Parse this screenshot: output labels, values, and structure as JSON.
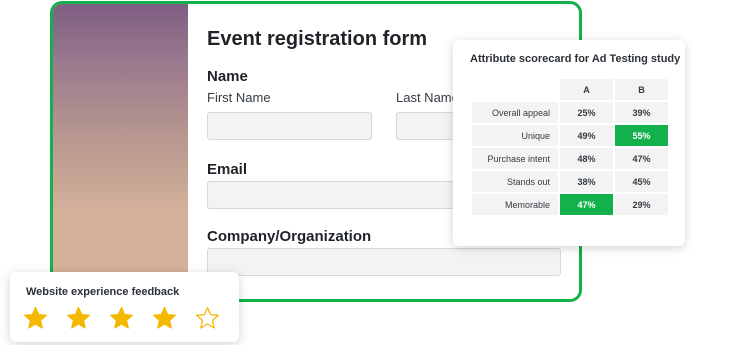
{
  "form": {
    "title": "Event registration form",
    "name_section": "Name",
    "first_name_label": "First Name",
    "last_name_label": "Last Name",
    "email_label": "Email",
    "company_label": "Company/Organization",
    "accent_color": "#12b14b"
  },
  "scorecard": {
    "title": "Attribute scorecard for Ad Testing study",
    "columns": [
      "A",
      "B"
    ],
    "rows": [
      {
        "label": "Overall appeal",
        "a": "25%",
        "b": "39%"
      },
      {
        "label": "Unique",
        "a": "49%",
        "b": "55%"
      },
      {
        "label": "Purchase intent",
        "a": "48%",
        "b": "47%"
      },
      {
        "label": "Stands out",
        "a": "38%",
        "b": "45%"
      },
      {
        "label": "Memorable",
        "a": "47%",
        "b": "29%"
      }
    ],
    "highlight_color": "#12b14b"
  },
  "feedback": {
    "title": "Website experience feedback",
    "rating": 4,
    "max_rating": 5,
    "star_color": "#f5b800"
  }
}
